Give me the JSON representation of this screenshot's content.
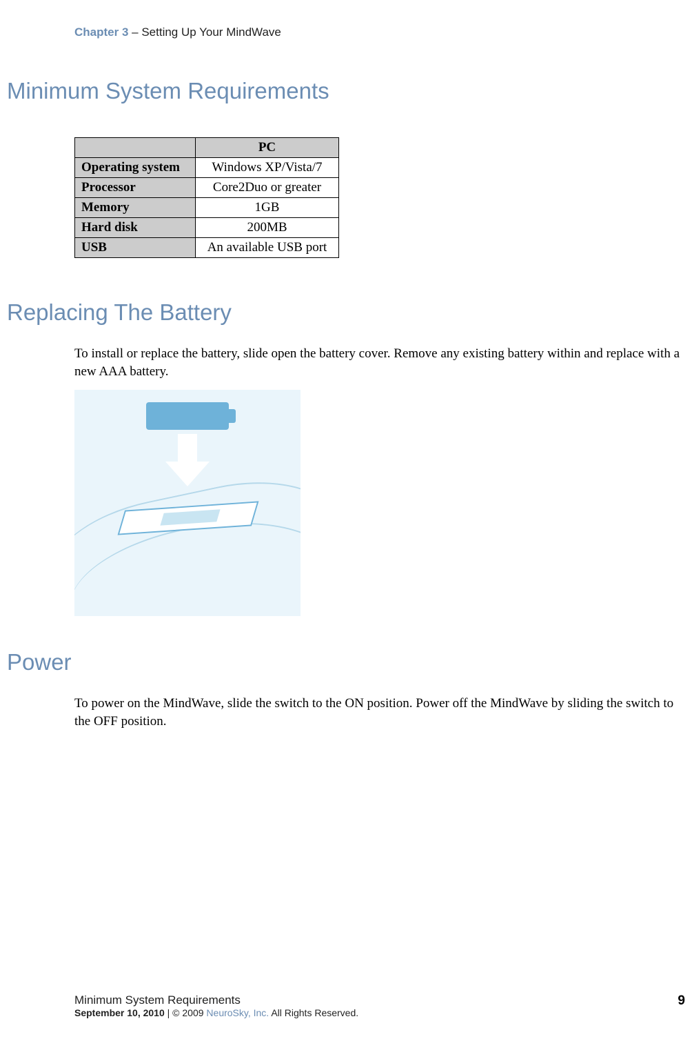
{
  "header": {
    "chapter_label": "Chapter 3",
    "separator": "  –  ",
    "chapter_title": "Setting Up Your MindWave"
  },
  "sections": {
    "requirements": {
      "heading": "Minimum System Requirements"
    },
    "battery": {
      "heading": "Replacing The Battery",
      "body": "To install or replace the battery, slide open the battery cover. Remove any existing battery within and replace with a new AAA battery."
    },
    "power": {
      "heading": "Power",
      "body": "To power on the MindWave, slide the switch to the ON position. Power off the MindWave by sliding the switch to the OFF position."
    }
  },
  "table": {
    "column_header": "PC",
    "rows": [
      {
        "label": "Operating system",
        "value": "Windows XP/Vista/7"
      },
      {
        "label": "Processor",
        "value": "Core2Duo or greater"
      },
      {
        "label": "Memory",
        "value": "1GB"
      },
      {
        "label": "Hard disk",
        "value": "200MB"
      },
      {
        "label": "USB",
        "value": "An available USB port"
      }
    ]
  },
  "footer": {
    "section_name": "Minimum System Requirements",
    "date": "September 10, 2010",
    "bar": "  |  ",
    "copyright_prefix": "© 2009 ",
    "company": "NeuroSky, Inc.",
    "copyright_suffix": " All Rights Reserved.",
    "page_number": "9"
  }
}
